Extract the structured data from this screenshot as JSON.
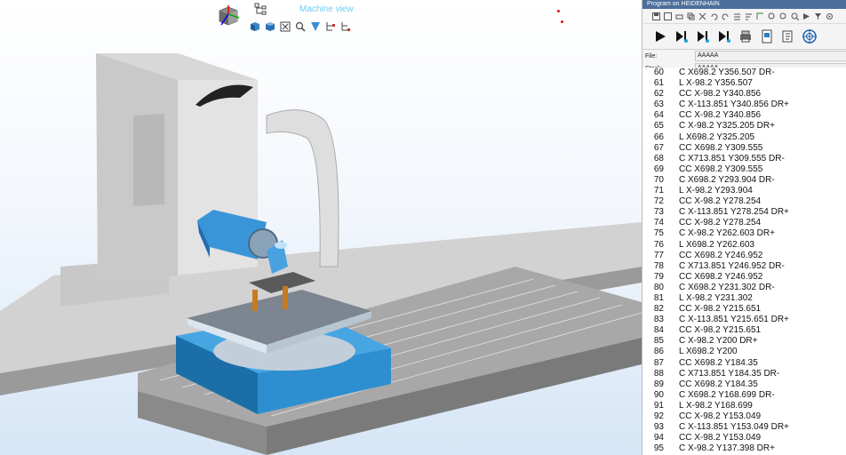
{
  "viewport": {
    "title": "Machine view",
    "toolbar_icons": [
      "iso-view-icon",
      "top-view-icon",
      "fit-view-icon",
      "zoom-icon",
      "shade-icon",
      "tree-add-icon",
      "tree-remove-icon"
    ]
  },
  "panel": {
    "title": "Program on HEIDENHAIN",
    "file_label": "File:",
    "file_value": "AAAAA",
    "stack_label": "Stack:",
    "stack_value": "AAAAA",
    "lines": [
      {
        "n": "60",
        "t": "C X698.2 Y356.507 DR-"
      },
      {
        "n": "61",
        "t": "L X-98.2 Y356.507"
      },
      {
        "n": "62",
        "t": "CC X-98.2 Y340.856"
      },
      {
        "n": "63",
        "t": "C X-113.851 Y340.856 DR+"
      },
      {
        "n": "64",
        "t": "CC X-98.2 Y340.856"
      },
      {
        "n": "65",
        "t": "C X-98.2 Y325.205 DR+"
      },
      {
        "n": "66",
        "t": "L X698.2 Y325.205"
      },
      {
        "n": "67",
        "t": "CC X698.2 Y309.555"
      },
      {
        "n": "68",
        "t": "C X713.851 Y309.555 DR-"
      },
      {
        "n": "69",
        "t": "CC X698.2 Y309.555"
      },
      {
        "n": "70",
        "t": "C X698.2 Y293.904 DR-"
      },
      {
        "n": "71",
        "t": "L X-98.2 Y293.904"
      },
      {
        "n": "72",
        "t": "CC X-98.2 Y278.254"
      },
      {
        "n": "73",
        "t": "C X-113.851 Y278.254 DR+"
      },
      {
        "n": "74",
        "t": "CC X-98.2 Y278.254"
      },
      {
        "n": "75",
        "t": "C X-98.2 Y262.603 DR+"
      },
      {
        "n": "76",
        "t": "L X698.2 Y262.603"
      },
      {
        "n": "77",
        "t": "CC X698.2 Y246.952"
      },
      {
        "n": "78",
        "t": "C X713.851 Y246.952 DR-"
      },
      {
        "n": "79",
        "t": "CC X698.2 Y246.952"
      },
      {
        "n": "80",
        "t": "C X698.2 Y231.302 DR-"
      },
      {
        "n": "81",
        "t": "L X-98.2 Y231.302"
      },
      {
        "n": "82",
        "t": "CC X-98.2 Y215.651"
      },
      {
        "n": "83",
        "t": "C X-113.851 Y215.651 DR+"
      },
      {
        "n": "84",
        "t": "CC X-98.2 Y215.651"
      },
      {
        "n": "85",
        "t": "C X-98.2 Y200 DR+"
      },
      {
        "n": "86",
        "t": "L X698.2 Y200"
      },
      {
        "n": "87",
        "t": "CC X698.2 Y184.35"
      },
      {
        "n": "88",
        "t": "C X713.851 Y184.35 DR-"
      },
      {
        "n": "89",
        "t": "CC X698.2 Y184.35"
      },
      {
        "n": "90",
        "t": "C X698.2 Y168.699 DR-"
      },
      {
        "n": "91",
        "t": "L X-98.2 Y168.699"
      },
      {
        "n": "92",
        "t": "CC X-98.2 Y153.049"
      },
      {
        "n": "93",
        "t": "C X-113.851 Y153.049 DR+"
      },
      {
        "n": "94",
        "t": "CC X-98.2 Y153.049"
      },
      {
        "n": "95",
        "t": "C X-98.2 Y137.398 DR+"
      }
    ]
  }
}
